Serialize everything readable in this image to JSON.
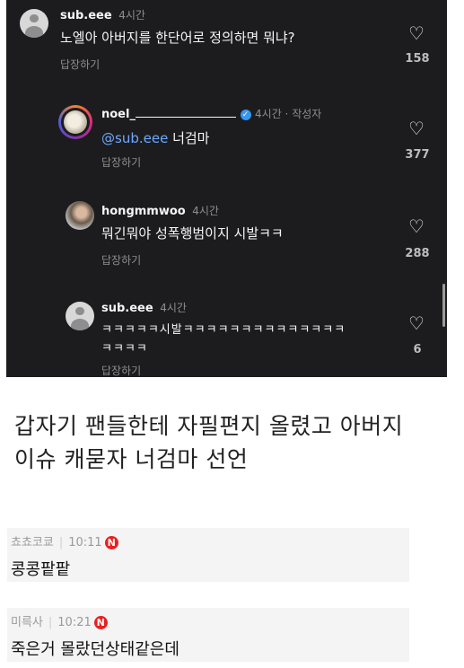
{
  "thread": {
    "comments": [
      {
        "username": "sub.eee",
        "time": "4시간",
        "text": "노엘아 아버지를 한단어로 정의하면 뭐냐?",
        "reply_label": "답장하기",
        "likes": "158"
      },
      {
        "username": "noel_",
        "time_meta": "4시간 · 작성자",
        "mention": "@sub.eee",
        "text": " 너검마",
        "reply_label": "답장하기",
        "likes": "377"
      },
      {
        "username": "hongmmwoo",
        "time": "4시간",
        "text": "뭐긴뭐야 성폭행범이지 시발ㅋㅋ",
        "reply_label": "답장하기",
        "likes": "288"
      },
      {
        "username": "sub.eee",
        "time": "4시간",
        "text_line1": "ㅋㅋㅋㅋㅋ시발ㅋㅋㅋㅋㅋㅋㅋㅋㅋㅋㅋㅋㅋㅋ",
        "text_line2": "ㅋㅋㅋㅋ",
        "reply_label": "답장하기",
        "likes": "6"
      }
    ]
  },
  "caption": {
    "line1": "갑자기 팬들한테 자필편지 올렸고 아버지",
    "line2": "이슈 캐묻자 너검마 선언"
  },
  "community_comments": [
    {
      "author": "쵸쵸코쿄",
      "time": "10:11",
      "badge": "N",
      "text": "콩콩팥팥"
    },
    {
      "author": "미륵사",
      "time": "10:21",
      "badge": "N",
      "text": "죽은거 몰랐던상태같은데"
    }
  ],
  "colors": {
    "dark_bg": "#1c1c1f",
    "mention": "#6ea8ff",
    "badge": "#e8201f",
    "verified": "#3897f0"
  }
}
